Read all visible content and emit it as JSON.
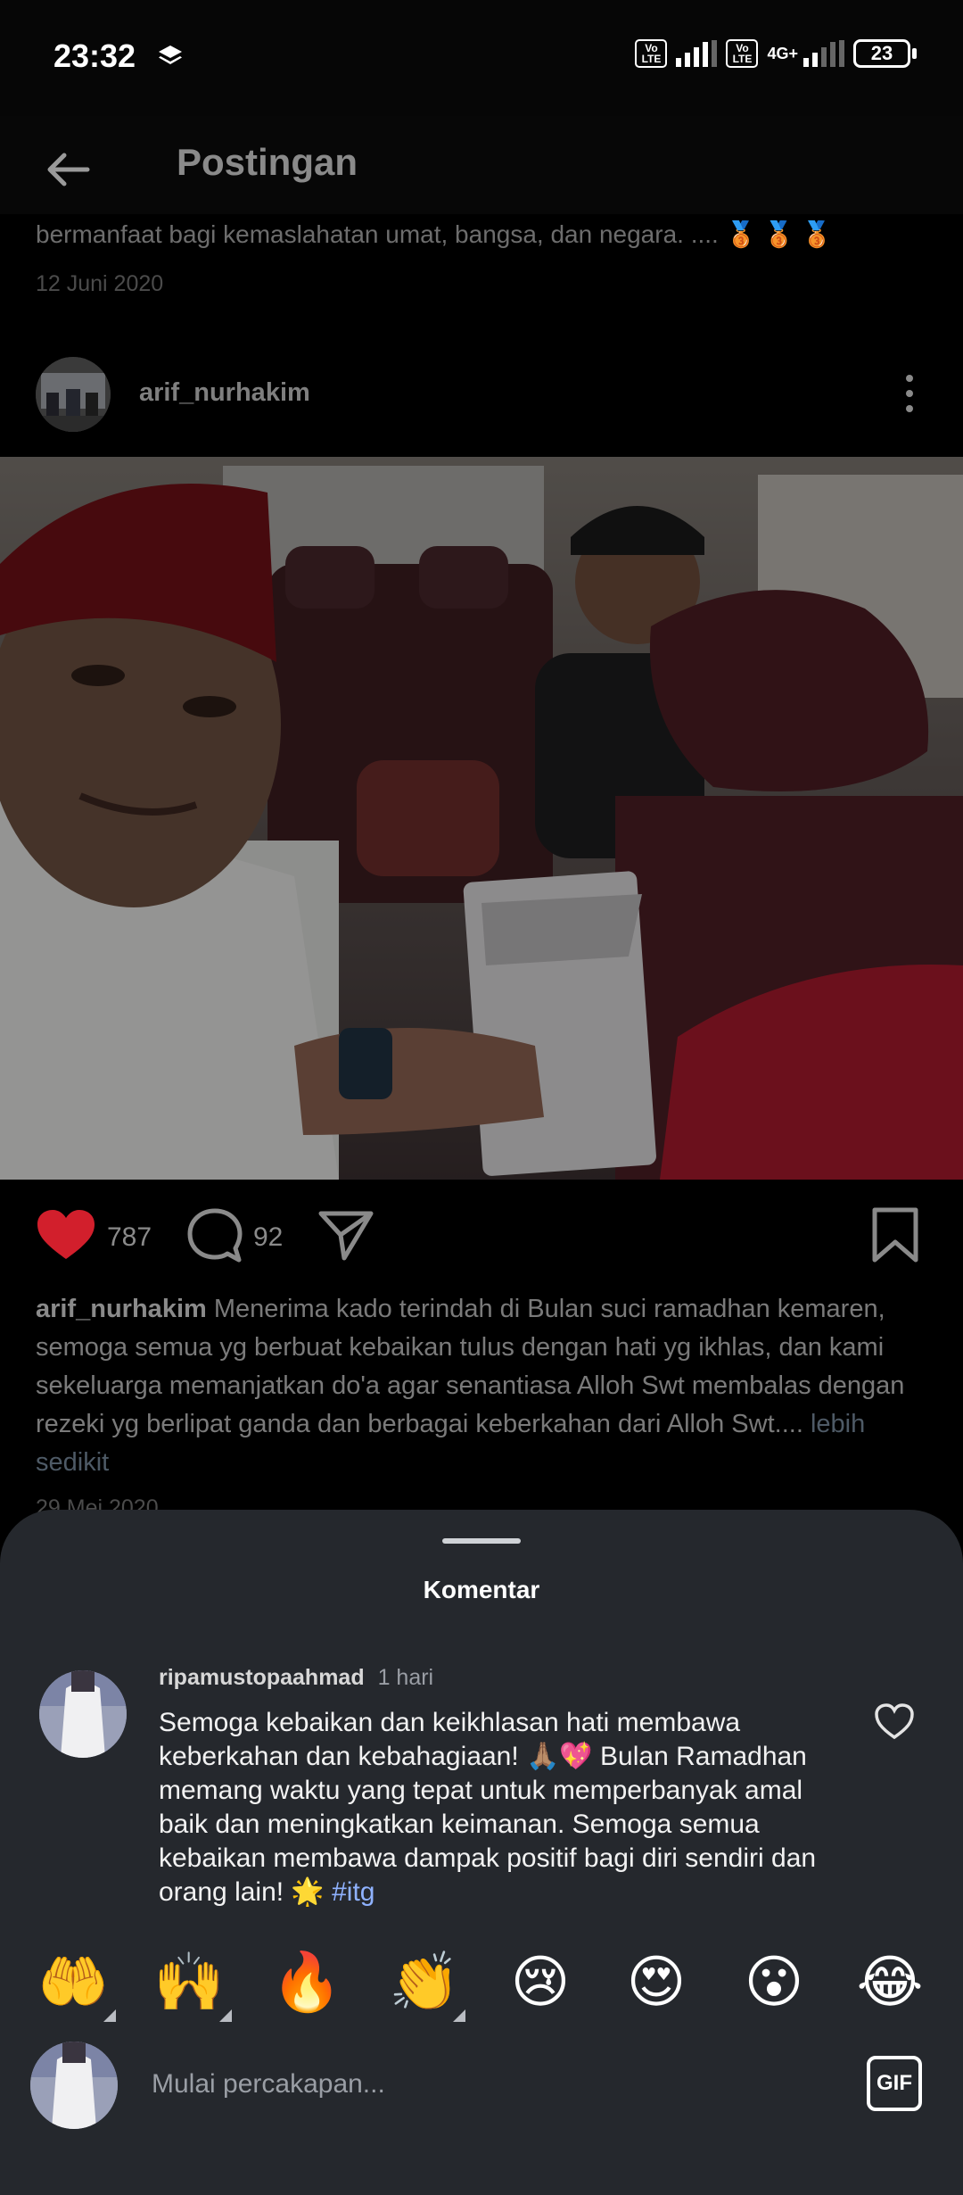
{
  "status_bar": {
    "time": "23:32",
    "volte_1": "Vo LTE",
    "volte_2": "Vo LTE",
    "network": "4G+",
    "battery": "23"
  },
  "header": {
    "title": "Postingan"
  },
  "previous_post": {
    "caption_tail": "bermanfaat bagi kemaslahatan umat, bangsa, dan negara. ....",
    "medals": "🥉 🥉 🥉",
    "date": "12 Juni 2020"
  },
  "post": {
    "username": "arif_nurhakim",
    "likes": "787",
    "comments": "92",
    "caption_user": "arif_nurhakim",
    "caption_text": " Menerima kado terindah di Bulan suci ramadhan kemaren, semoga semua yg berbuat kebaikan tulus dengan hati yg ikhlas, dan kami sekeluarga memanjatkan do'a agar senantiasa Alloh Swt membalas dengan rezeki yg berlipat ganda dan berbagai keberkahan dari Alloh Swt.... ",
    "caption_more": "lebih sedikit",
    "date": "29 Mei 2020"
  },
  "comments_sheet": {
    "title": "Komentar",
    "comments": [
      {
        "username": "ripamustopaahmad",
        "time": "1 hari",
        "text": "Semoga kebaikan dan keikhlasan hati membawa keberkahan dan kebahagiaan! 🙏🏽💖 Bulan Ramadhan memang waktu yang tepat untuk memperbanyak amal baik dan meningkatkan keimanan. Semoga semua kebaikan membawa dampak positif bagi diri sendiri dan orang lain! 🌟 ",
        "hashtag": "#itg"
      }
    ],
    "emojis": [
      "🤲",
      "🙌",
      "🔥",
      "👏",
      "😢",
      "😍",
      "😮",
      "😂"
    ],
    "composer_placeholder": "Mulai percakapan...",
    "gif_label": "GIF"
  },
  "colors": {
    "like_red": "#d21f2c",
    "sheet_bg": "#25282d",
    "hashtag": "#8fb2ff"
  },
  "icons": [
    "back-arrow-icon",
    "more-vertical-icon",
    "heart-icon",
    "comment-bubble-icon",
    "share-paper-plane-icon",
    "bookmark-icon",
    "heart-outline-icon",
    "gif-icon"
  ]
}
